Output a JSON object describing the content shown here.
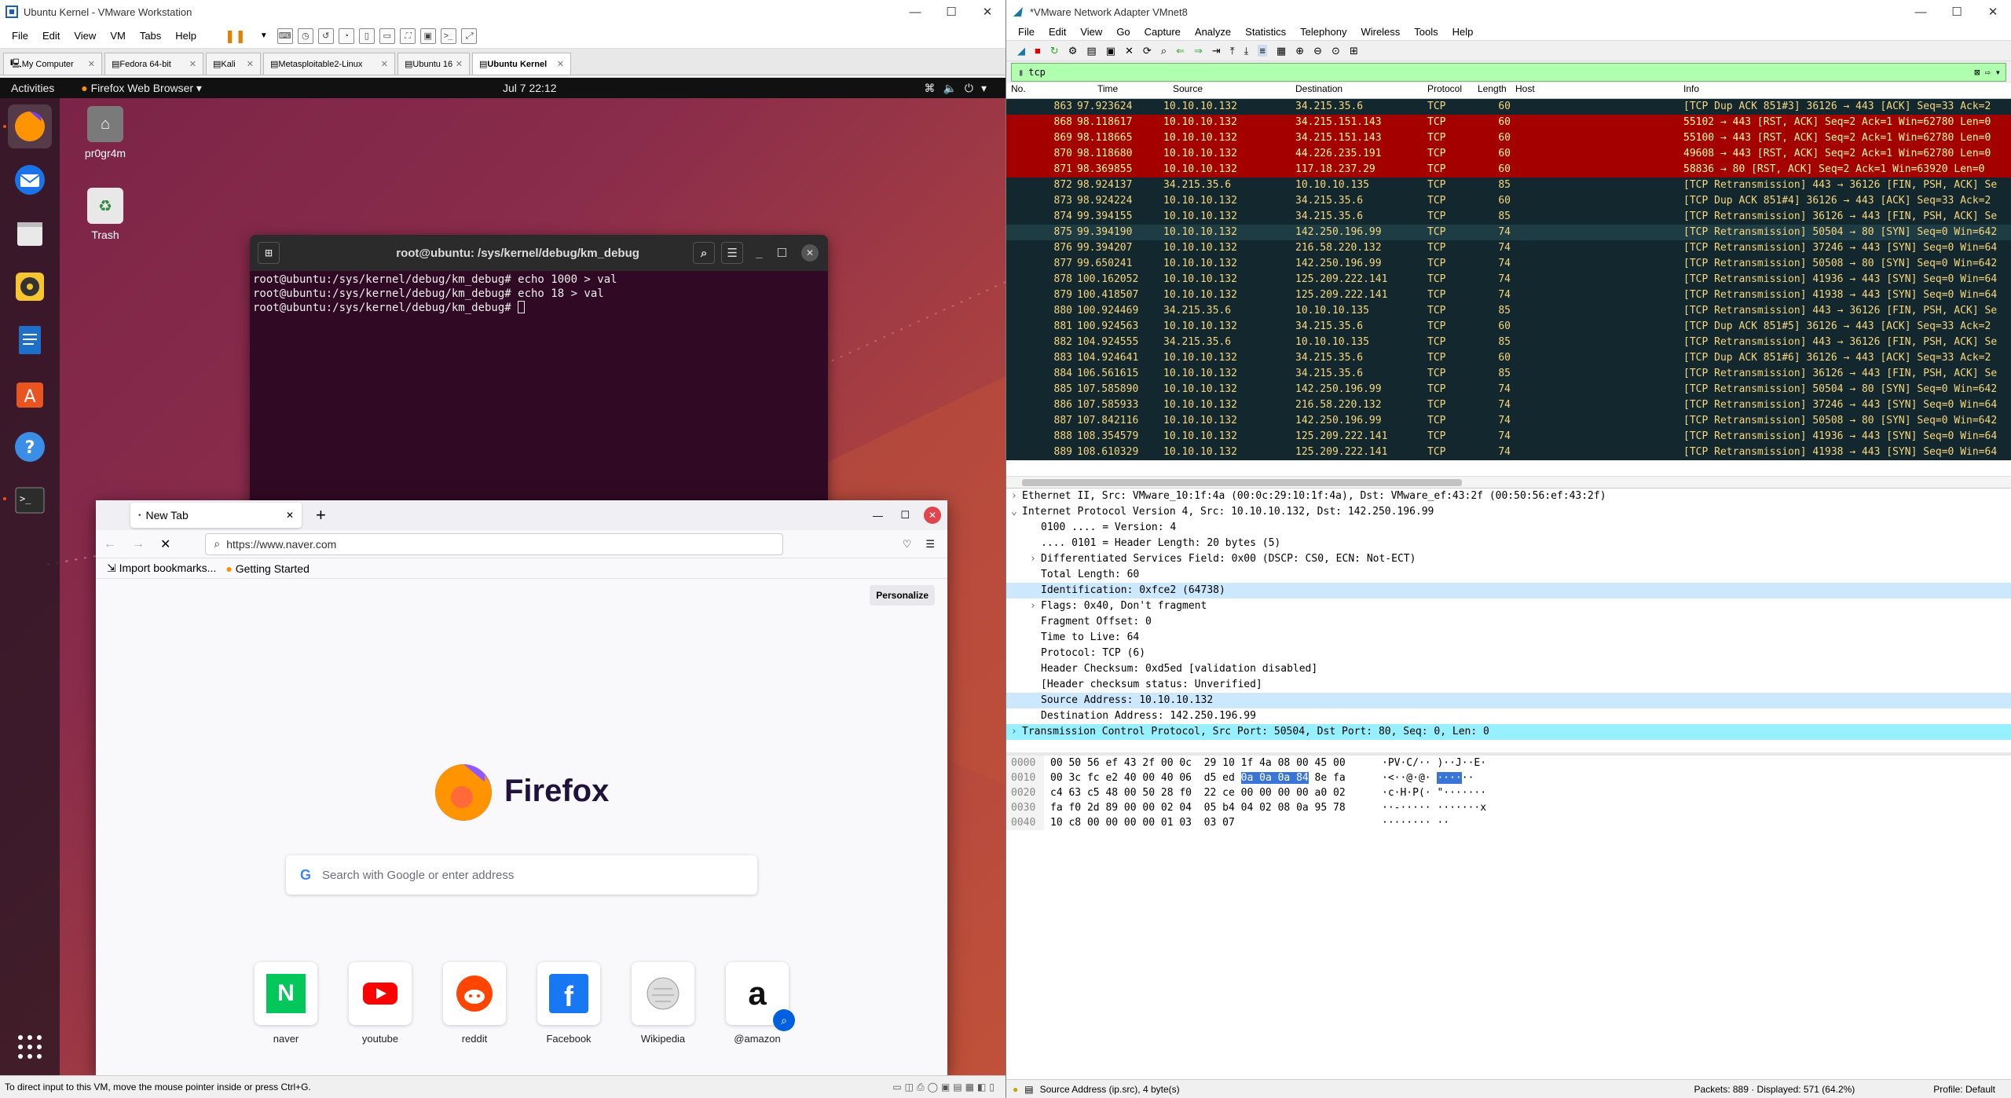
{
  "vmware": {
    "title": "Ubuntu Kernel - VMware Workstation",
    "menu": [
      "File",
      "Edit",
      "View",
      "VM",
      "Tabs",
      "Help"
    ],
    "tabs": [
      {
        "label": "My Computer",
        "active": false
      },
      {
        "label": "Fedora 64-bit",
        "active": false
      },
      {
        "label": "Kali",
        "active": false
      },
      {
        "label": "Metasploitable2-Linux",
        "active": false
      },
      {
        "label": "Ubuntu 16",
        "active": false
      },
      {
        "label": "Ubuntu Kernel",
        "active": true
      }
    ],
    "status": "To direct input to this VM, move the mouse pointer inside or press Ctrl+G."
  },
  "ubuntu": {
    "activities": "Activities",
    "app_menu": "Firefox Web Browser",
    "clock": "Jul 7  22:12",
    "desktop_icons": [
      {
        "label": "pr0gr4m",
        "icon": "home-folder-icon"
      },
      {
        "label": "Trash",
        "icon": "trash-icon"
      }
    ],
    "dock_icons": [
      "firefox-icon",
      "thunderbird-icon",
      "files-icon",
      "rhythmbox-icon",
      "libreoffice-writer-icon",
      "software-center-icon",
      "help-icon",
      "terminal-icon",
      "show-apps-icon"
    ]
  },
  "terminal": {
    "title": "root@ubuntu: /sys/kernel/debug/km_debug",
    "lines": [
      "root@ubuntu:/sys/kernel/debug/km_debug# echo 1000 > val",
      "root@ubuntu:/sys/kernel/debug/km_debug# echo 18 > val",
      "root@ubuntu:/sys/kernel/debug/km_debug# "
    ]
  },
  "firefox": {
    "tab_label": "New Tab",
    "url": "https://www.naver.com",
    "bookmarks": [
      "Import bookmarks...",
      "Getting Started"
    ],
    "personalize": "Personalize",
    "brand": "Firefox",
    "search_placeholder": "Search with Google or enter address",
    "shortcuts": [
      {
        "label": "naver",
        "icon": "naver-icon",
        "color": "#03c75a"
      },
      {
        "label": "youtube",
        "icon": "youtube-icon",
        "color": "#ff0000"
      },
      {
        "label": "reddit",
        "icon": "reddit-icon",
        "color": "#ff4500"
      },
      {
        "label": "Facebook",
        "icon": "facebook-icon",
        "color": "#1877f2"
      },
      {
        "label": "Wikipedia",
        "icon": "wikipedia-icon",
        "color": "#888888"
      },
      {
        "label": "@amazon",
        "icon": "amazon-icon",
        "color": "#222222"
      }
    ]
  },
  "wireshark": {
    "title": "*VMware Network Adapter VMnet8",
    "menu": [
      "File",
      "Edit",
      "View",
      "Go",
      "Capture",
      "Analyze",
      "Statistics",
      "Telephony",
      "Wireless",
      "Tools",
      "Help"
    ],
    "filter": "tcp",
    "columns": [
      "No.",
      "Time",
      "Source",
      "Destination",
      "Protocol",
      "Length",
      "Host",
      "Info"
    ],
    "packets": [
      {
        "no": "863",
        "time": "97.923624",
        "src": "10.10.10.132",
        "dst": "34.215.35.6",
        "proto": "TCP",
        "len": "60",
        "info": "[TCP Dup ACK 851#3] 36126 → 443 [ACK] Seq=33 Ack=2",
        "style": "dark"
      },
      {
        "no": "868",
        "time": "98.118617",
        "src": "10.10.10.132",
        "dst": "34.215.151.143",
        "proto": "TCP",
        "len": "60",
        "info": "55102 → 443 [RST, ACK] Seq=2 Ack=1 Win=62780 Len=0",
        "style": "red"
      },
      {
        "no": "869",
        "time": "98.118665",
        "src": "10.10.10.132",
        "dst": "34.215.151.143",
        "proto": "TCP",
        "len": "60",
        "info": "55100 → 443 [RST, ACK] Seq=2 Ack=1 Win=62780 Len=0",
        "style": "red"
      },
      {
        "no": "870",
        "time": "98.118680",
        "src": "10.10.10.132",
        "dst": "44.226.235.191",
        "proto": "TCP",
        "len": "60",
        "info": "49608 → 443 [RST, ACK] Seq=2 Ack=1 Win=62780 Len=0",
        "style": "red"
      },
      {
        "no": "871",
        "time": "98.369855",
        "src": "10.10.10.132",
        "dst": "117.18.237.29",
        "proto": "TCP",
        "len": "60",
        "info": "58836 → 80 [RST, ACK] Seq=2 Ack=1 Win=63920 Len=0",
        "style": "red"
      },
      {
        "no": "872",
        "time": "98.924137",
        "src": "34.215.35.6",
        "dst": "10.10.10.135",
        "proto": "TCP",
        "len": "85",
        "info": "[TCP Retransmission] 443 → 36126 [FIN, PSH, ACK] Se",
        "style": "dark"
      },
      {
        "no": "873",
        "time": "98.924224",
        "src": "10.10.10.132",
        "dst": "34.215.35.6",
        "proto": "TCP",
        "len": "60",
        "info": "[TCP Dup ACK 851#4] 36126 → 443 [ACK] Seq=33 Ack=2",
        "style": "dark"
      },
      {
        "no": "874",
        "time": "99.394155",
        "src": "10.10.10.132",
        "dst": "34.215.35.6",
        "proto": "TCP",
        "len": "85",
        "info": "[TCP Retransmission] 36126 → 443 [FIN, PSH, ACK] Se",
        "style": "dark"
      },
      {
        "no": "875",
        "time": "99.394190",
        "src": "10.10.10.132",
        "dst": "142.250.196.99",
        "proto": "TCP",
        "len": "74",
        "info": "[TCP Retransmission] 50504 → 80 [SYN] Seq=0 Win=642",
        "style": "sel"
      },
      {
        "no": "876",
        "time": "99.394207",
        "src": "10.10.10.132",
        "dst": "216.58.220.132",
        "proto": "TCP",
        "len": "74",
        "info": "[TCP Retransmission] 37246 → 443 [SYN] Seq=0 Win=64",
        "style": "dark"
      },
      {
        "no": "877",
        "time": "99.650241",
        "src": "10.10.10.132",
        "dst": "142.250.196.99",
        "proto": "TCP",
        "len": "74",
        "info": "[TCP Retransmission] 50508 → 80 [SYN] Seq=0 Win=642",
        "style": "dark"
      },
      {
        "no": "878",
        "time": "100.162052",
        "src": "10.10.10.132",
        "dst": "125.209.222.141",
        "proto": "TCP",
        "len": "74",
        "info": "[TCP Retransmission] 41936 → 443 [SYN] Seq=0 Win=64",
        "style": "dark"
      },
      {
        "no": "879",
        "time": "100.418507",
        "src": "10.10.10.132",
        "dst": "125.209.222.141",
        "proto": "TCP",
        "len": "74",
        "info": "[TCP Retransmission] 41938 → 443 [SYN] Seq=0 Win=64",
        "style": "dark"
      },
      {
        "no": "880",
        "time": "100.924469",
        "src": "34.215.35.6",
        "dst": "10.10.10.135",
        "proto": "TCP",
        "len": "85",
        "info": "[TCP Retransmission] 443 → 36126 [FIN, PSH, ACK] Se",
        "style": "dark"
      },
      {
        "no": "881",
        "time": "100.924563",
        "src": "10.10.10.132",
        "dst": "34.215.35.6",
        "proto": "TCP",
        "len": "60",
        "info": "[TCP Dup ACK 851#5] 36126 → 443 [ACK] Seq=33 Ack=2",
        "style": "dark"
      },
      {
        "no": "882",
        "time": "104.924555",
        "src": "34.215.35.6",
        "dst": "10.10.10.135",
        "proto": "TCP",
        "len": "85",
        "info": "[TCP Retransmission] 443 → 36126 [FIN, PSH, ACK] Se",
        "style": "dark"
      },
      {
        "no": "883",
        "time": "104.924641",
        "src": "10.10.10.132",
        "dst": "34.215.35.6",
        "proto": "TCP",
        "len": "60",
        "info": "[TCP Dup ACK 851#6] 36126 → 443 [ACK] Seq=33 Ack=2",
        "style": "dark"
      },
      {
        "no": "884",
        "time": "106.561615",
        "src": "10.10.10.132",
        "dst": "34.215.35.6",
        "proto": "TCP",
        "len": "85",
        "info": "[TCP Retransmission] 36126 → 443 [FIN, PSH, ACK] Se",
        "style": "dark"
      },
      {
        "no": "885",
        "time": "107.585890",
        "src": "10.10.10.132",
        "dst": "142.250.196.99",
        "proto": "TCP",
        "len": "74",
        "info": "[TCP Retransmission] 50504 → 80 [SYN] Seq=0 Win=642",
        "style": "dark"
      },
      {
        "no": "886",
        "time": "107.585933",
        "src": "10.10.10.132",
        "dst": "216.58.220.132",
        "proto": "TCP",
        "len": "74",
        "info": "[TCP Retransmission] 37246 → 443 [SYN] Seq=0 Win=64",
        "style": "dark"
      },
      {
        "no": "887",
        "time": "107.842116",
        "src": "10.10.10.132",
        "dst": "142.250.196.99",
        "proto": "TCP",
        "len": "74",
        "info": "[TCP Retransmission] 50508 → 80 [SYN] Seq=0 Win=642",
        "style": "dark"
      },
      {
        "no": "888",
        "time": "108.354579",
        "src": "10.10.10.132",
        "dst": "125.209.222.141",
        "proto": "TCP",
        "len": "74",
        "info": "[TCP Retransmission] 41936 → 443 [SYN] Seq=0 Win=64",
        "style": "dark"
      },
      {
        "no": "889",
        "time": "108.610329",
        "src": "10.10.10.132",
        "dst": "125.209.222.141",
        "proto": "TCP",
        "len": "74",
        "info": "[TCP Retransmission] 41938 → 443 [SYN] Seq=0 Win=64",
        "style": "dark"
      }
    ],
    "details": [
      {
        "text": "Ethernet II, Src: VMware_10:1f:4a (00:0c:29:10:1f:4a), Dst: VMware_ef:43:2f (00:50:56:ef:43:2f)",
        "indent": 0,
        "arrow": "›",
        "style": ""
      },
      {
        "text": "Internet Protocol Version 4, Src: 10.10.10.132, Dst: 142.250.196.99",
        "indent": 0,
        "arrow": "⌄",
        "style": ""
      },
      {
        "text": "0100 .... = Version: 4",
        "indent": 2,
        "arrow": "",
        "style": ""
      },
      {
        "text": ".... 0101 = Header Length: 20 bytes (5)",
        "indent": 2,
        "arrow": "",
        "style": ""
      },
      {
        "text": "Differentiated Services Field: 0x00 (DSCP: CS0, ECN: Not-ECT)",
        "indent": 2,
        "arrow": "›",
        "style": ""
      },
      {
        "text": "Total Length: 60",
        "indent": 2,
        "arrow": "",
        "style": ""
      },
      {
        "text": "Identification: 0xfce2 (64738)",
        "indent": 2,
        "arrow": "",
        "style": "hl"
      },
      {
        "text": "Flags: 0x40, Don't fragment",
        "indent": 2,
        "arrow": "›",
        "style": ""
      },
      {
        "text": "Fragment Offset: 0",
        "indent": 2,
        "arrow": "",
        "style": ""
      },
      {
        "text": "Time to Live: 64",
        "indent": 2,
        "arrow": "",
        "style": ""
      },
      {
        "text": "Protocol: TCP (6)",
        "indent": 2,
        "arrow": "",
        "style": ""
      },
      {
        "text": "Header Checksum: 0xd5ed [validation disabled]",
        "indent": 2,
        "arrow": "",
        "style": ""
      },
      {
        "text": "[Header checksum status: Unverified]",
        "indent": 2,
        "arrow": "",
        "style": ""
      },
      {
        "text": "Source Address: 10.10.10.132",
        "indent": 2,
        "arrow": "",
        "style": "hl"
      },
      {
        "text": "Destination Address: 142.250.196.99",
        "indent": 2,
        "arrow": "",
        "style": ""
      },
      {
        "text": "Transmission Control Protocol, Src Port: 50504, Dst Port: 80, Seq: 0, Len: 0",
        "indent": 0,
        "arrow": "›",
        "style": "sel"
      }
    ],
    "bytes": [
      {
        "off": "0000",
        "hex": "00 50 56 ef 43 2f 00 0c  29 10 1f 4a 08 00 45 00",
        "ascii": "·PV·C/·· )··J··E·"
      },
      {
        "off": "0010",
        "hex": "00 3c fc e2 40 00 40 06  d5 ed ",
        "hexhl": "0a 0a 0a 84",
        "hexrest": " 8e fa",
        "ascii": "·<··@·@· ",
        "asciihl": "····",
        "asciirest": "··"
      },
      {
        "off": "0020",
        "hex": "c4 63 c5 48 00 50 28 f0  22 ce 00 00 00 00 a0 02",
        "ascii": "·c·H·P(· \"·······"
      },
      {
        "off": "0030",
        "hex": "fa f0 2d 89 00 00 02 04  05 b4 04 02 08 0a 95 78",
        "ascii": "··-····· ·······x"
      },
      {
        "off": "0040",
        "hex": "10 c8 00 00 00 00 01 03  03 07",
        "ascii": "········ ··"
      }
    ],
    "status_left": "Source Address (ip.src), 4 byte(s)",
    "status_packets": "Packets: 889 · Displayed: 571 (64.2%)",
    "status_profile": "Profile: Default"
  }
}
